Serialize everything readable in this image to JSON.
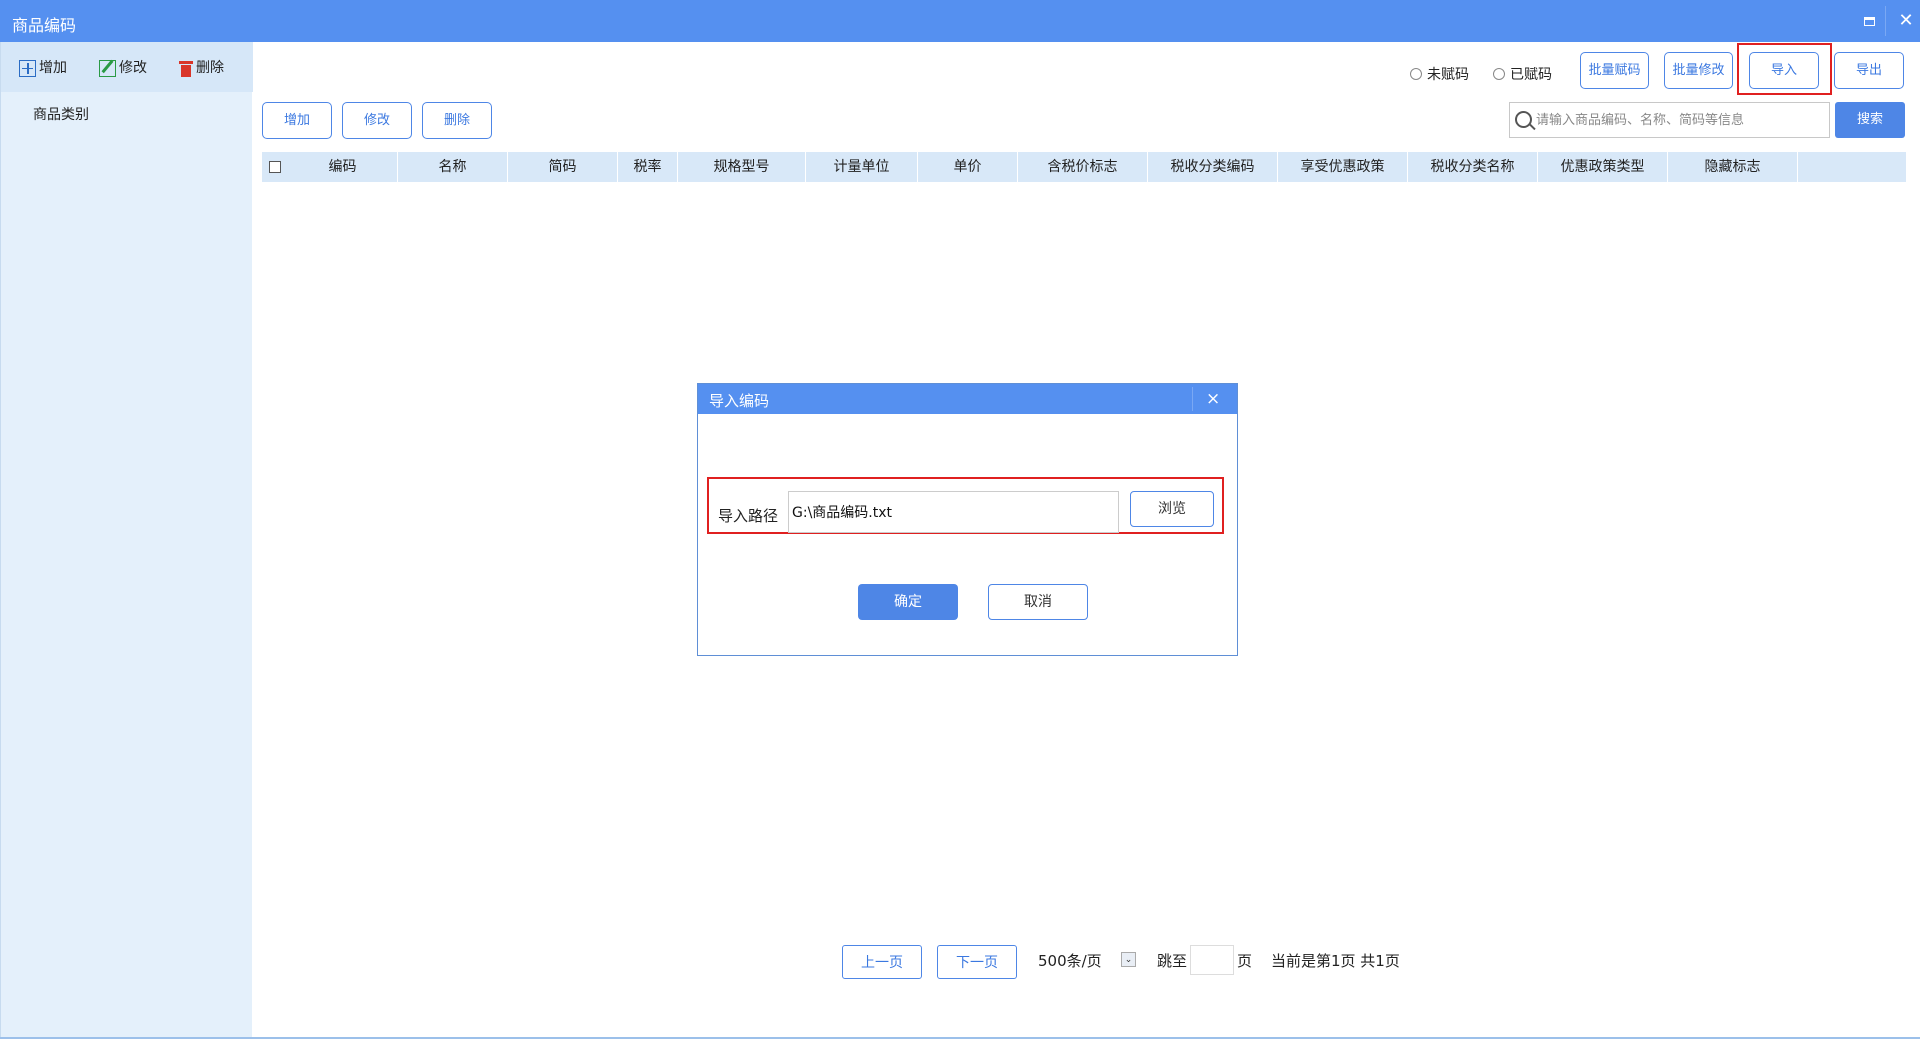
{
  "window": {
    "title": "商品编码",
    "max_icon": "maximize-icon",
    "close_icon": "close-icon",
    "close_glyph": "✕"
  },
  "sidebar": {
    "toolbar": {
      "add_label": "增加",
      "edit_label": "修改",
      "delete_label": "删除"
    },
    "category_label": "商品类别"
  },
  "filters": {
    "unassigned_label": "未赋码",
    "assigned_label": "已赋码"
  },
  "top_actions": {
    "batch_assign": "批量赋码",
    "batch_edit": "批量修改",
    "import": "导入",
    "export": "导出"
  },
  "table_actions": {
    "add": "增加",
    "edit": "修改",
    "delete": "删除"
  },
  "search": {
    "placeholder": "请输入商品编码、名称、简码等信息",
    "button": "搜索"
  },
  "table": {
    "columns": [
      "编码",
      "名称",
      "简码",
      "税率",
      "规格型号",
      "计量单位",
      "单价",
      "含税价标志",
      "税收分类编码",
      "享受优惠政策",
      "税收分类名称",
      "优惠政策类型",
      "隐藏标志"
    ],
    "rows": []
  },
  "pagination": {
    "prev": "上一页",
    "next": "下一页",
    "page_size": "500条/页",
    "dropdown_glyph": "⌄",
    "jump_to": "跳至",
    "page_unit": "页",
    "status": "当前是第1页 共1页",
    "jump_value": ""
  },
  "dialog": {
    "title": "导入编码",
    "close_glyph": "×",
    "path_label": "导入路径",
    "path_value": "G:\\商品编码.txt",
    "browse": "浏览",
    "ok": "确定",
    "cancel": "取消"
  },
  "colors": {
    "titlebar": "#5590f0",
    "accent": "#4e86e6",
    "sidebar_bg": "#e4f0fb",
    "table_header_bg": "#d8e8f8",
    "highlight_border": "#e02020"
  }
}
